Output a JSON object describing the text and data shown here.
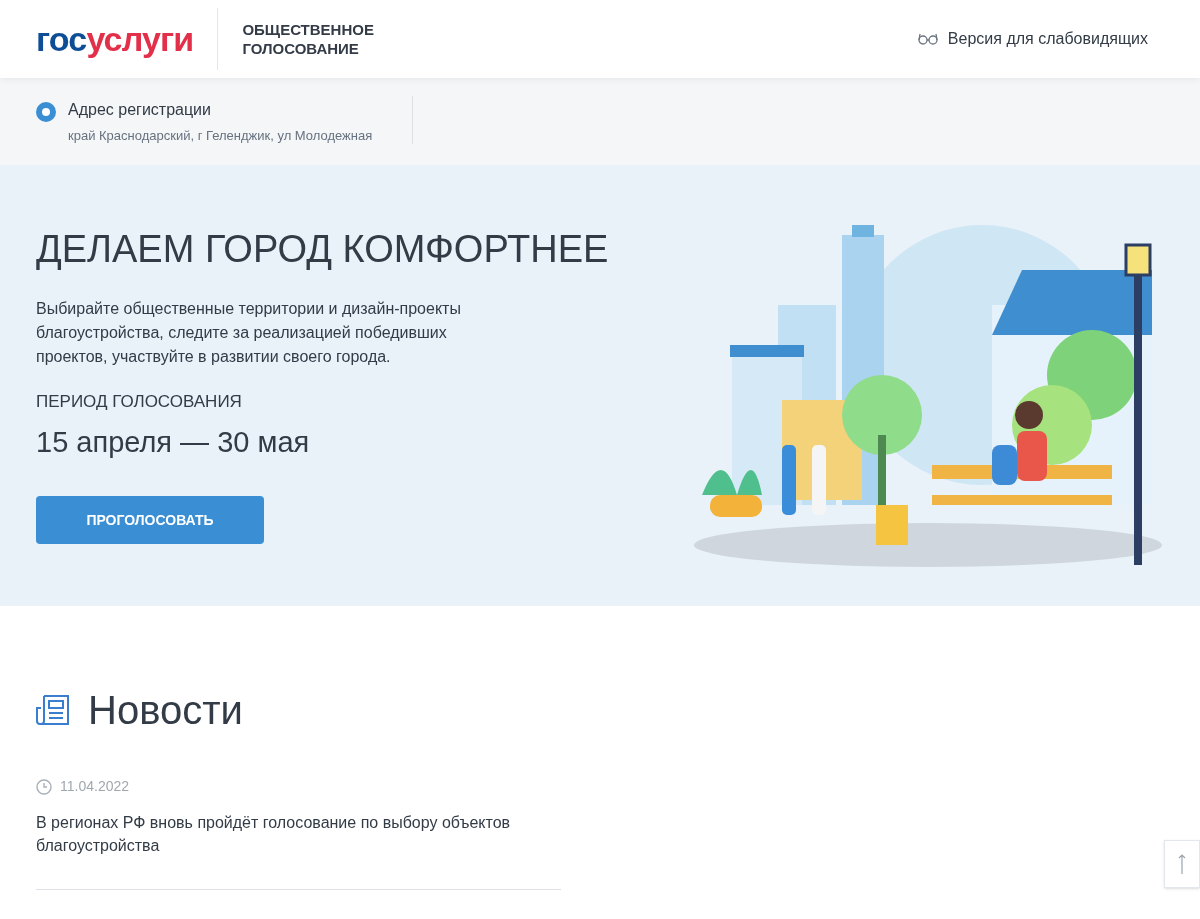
{
  "header": {
    "logo": {
      "part_1": "гос",
      "part_2": "услуги"
    },
    "section_title": "ОБЩЕСТВЕННОЕ ГОЛОСОВАНИЕ",
    "accessibility_link": "Версия для слабовидящих"
  },
  "address": {
    "label": "Адрес регистрации",
    "value": "край Краснодарский, г Геленджик, ул Молодежная",
    "selected": true
  },
  "hero": {
    "title": "ДЕЛАЕМ ГОРОД КОМФОРТНЕЕ",
    "description": "Выбирайте общественные территории и дизайн-проекты благоустройства, следите за реализацией победивших проектов, участвуйте в развитии своего города.",
    "period_label": "ПЕРИОД ГОЛОСОВАНИЯ",
    "period": "15 апреля — 30 мая",
    "button": "ПРОГОЛОСОВАТЬ"
  },
  "news": {
    "title": "Новости",
    "items": [
      {
        "date": "11.04.2022",
        "text": "В регионах РФ вновь пройдёт голосование по выбору объектов благоустройства"
      }
    ]
  }
}
